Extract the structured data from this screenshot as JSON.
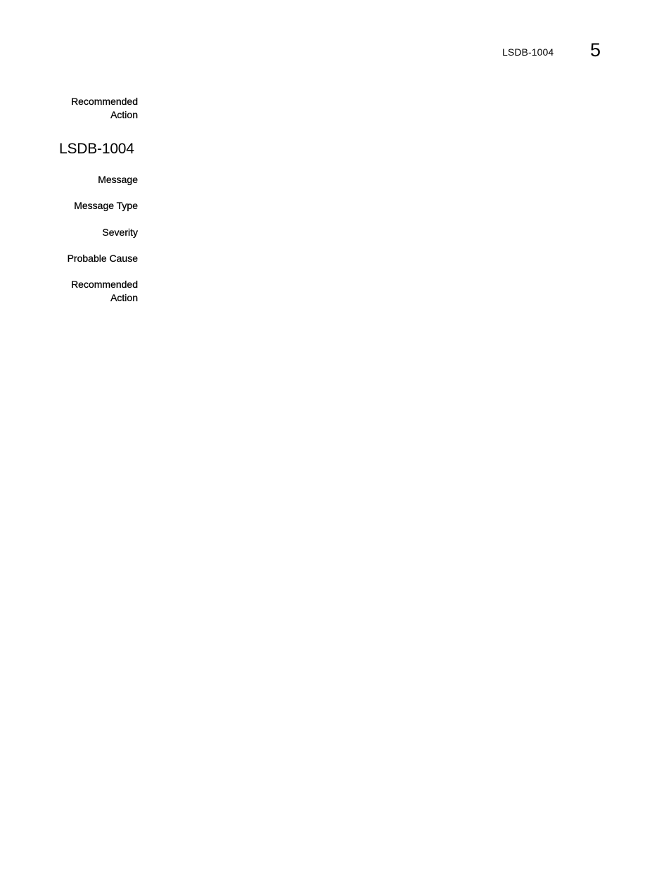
{
  "header": {
    "running_title": "LSDB-1004",
    "chapter_number": "5"
  },
  "previous_entry": {
    "recommended_action_label": "Recommended Action",
    "recommended_action_label_line1": "Recommended",
    "recommended_action_label_line2": "Action",
    "recommended_action_value": ""
  },
  "entry": {
    "id": "LSDB-1004",
    "fields": [
      {
        "label": "Message",
        "value": ""
      },
      {
        "label": "Message Type",
        "value": ""
      },
      {
        "label": "Severity",
        "value": ""
      },
      {
        "label": "Probable Cause",
        "value": ""
      },
      {
        "label_line1": "Recommended",
        "label_line2": "Action",
        "label": "Recommended Action",
        "value": ""
      }
    ]
  }
}
